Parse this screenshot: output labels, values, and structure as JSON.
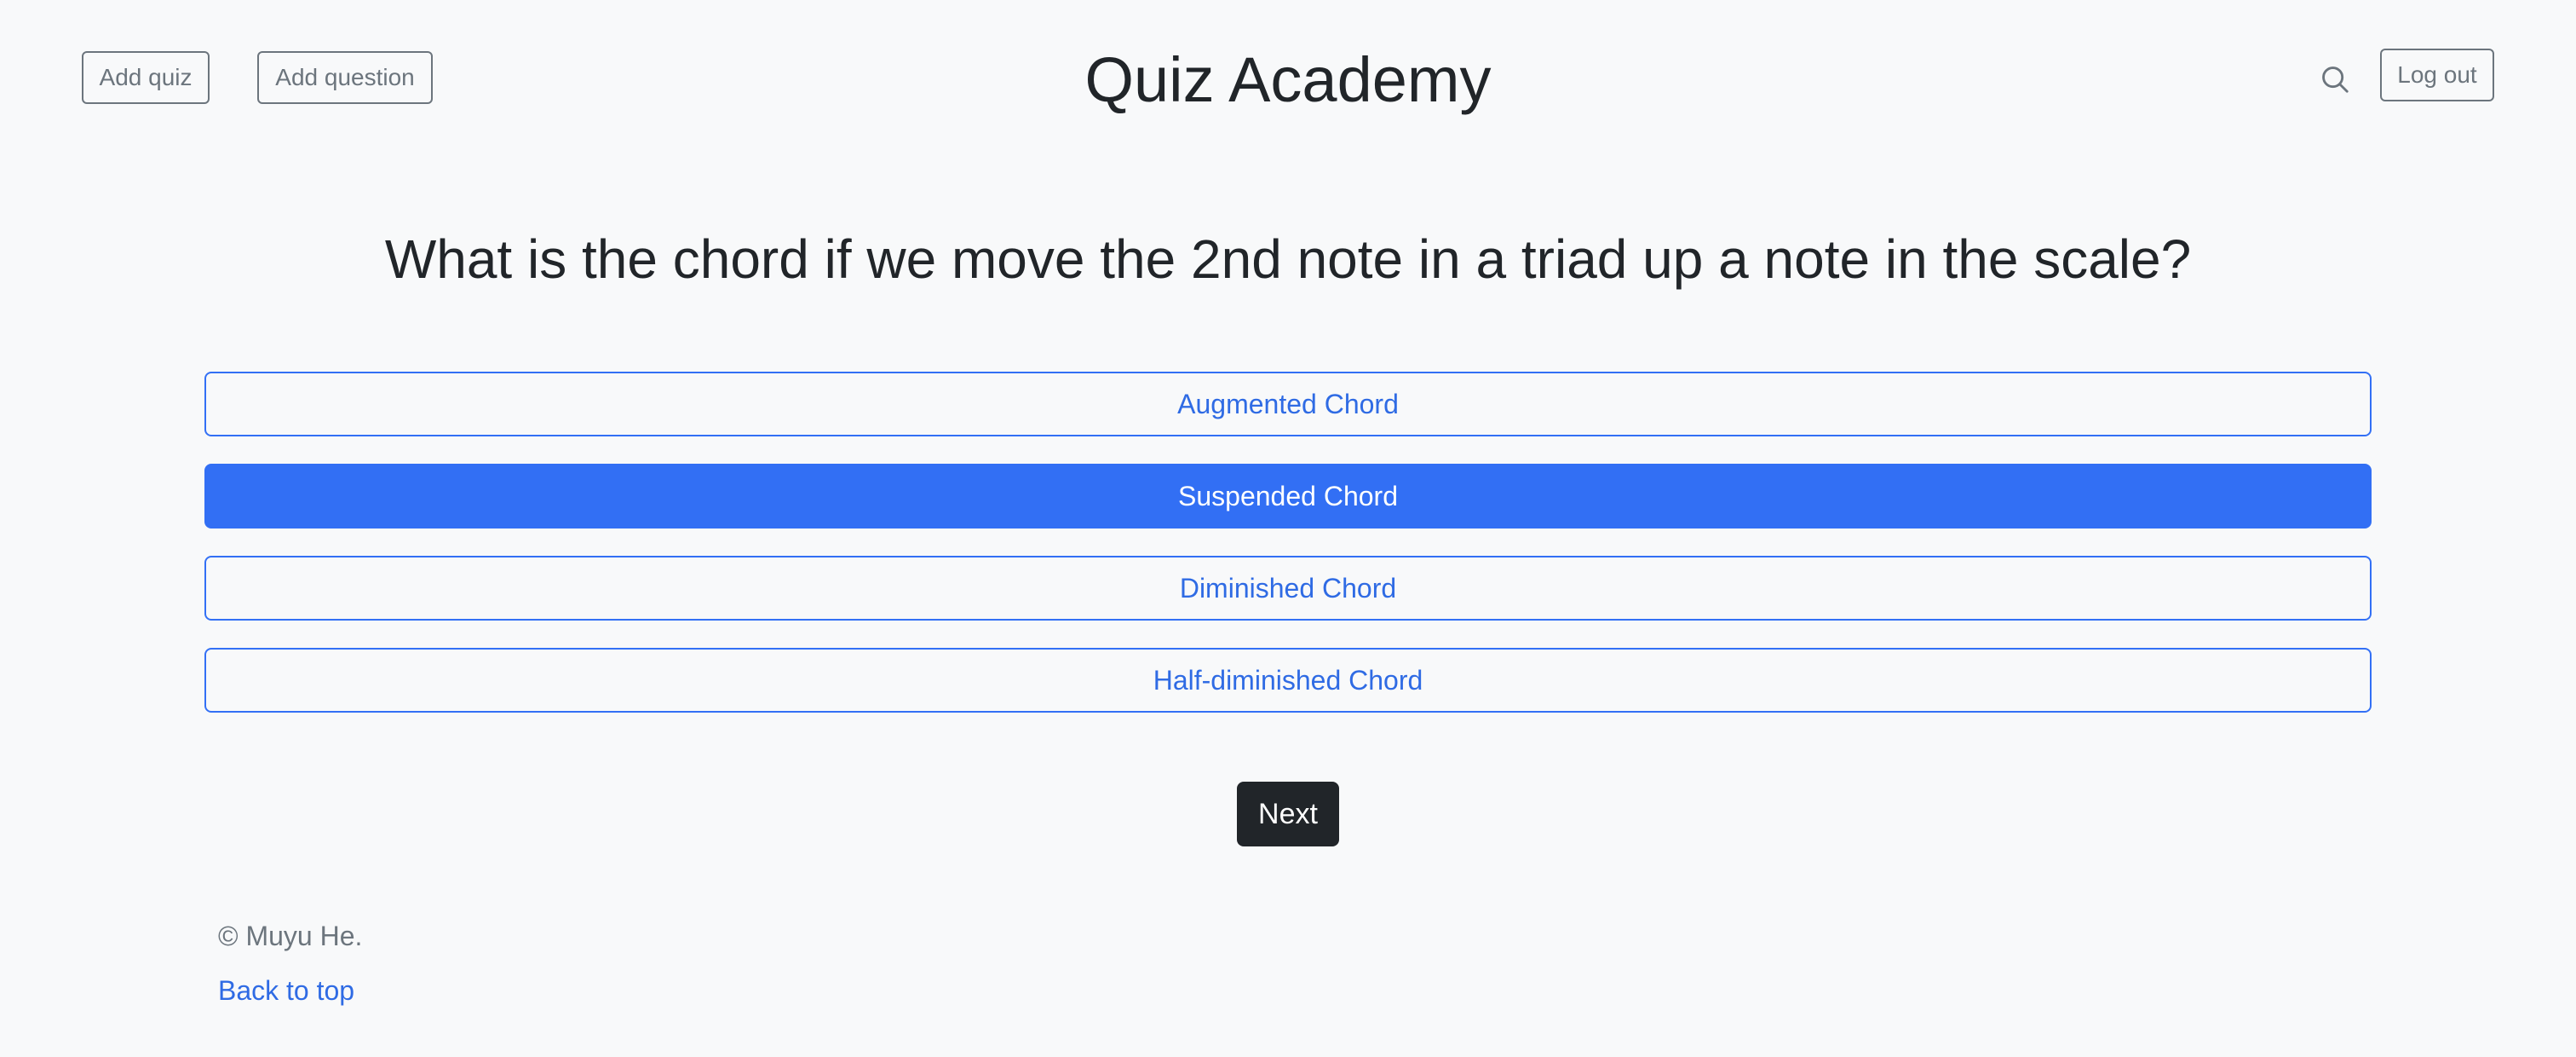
{
  "header": {
    "add_quiz_label": "Add quiz",
    "add_question_label": "Add question",
    "title": "Quiz Academy",
    "search_icon": "search-icon",
    "logout_label": "Log out"
  },
  "quiz": {
    "question": "What is the chord if we move the 2nd note in a triad up a note in the scale?",
    "answers": [
      {
        "label": "Augmented Chord",
        "selected": false
      },
      {
        "label": "Suspended Chord",
        "selected": true
      },
      {
        "label": "Diminished Chord",
        "selected": false
      },
      {
        "label": "Half-diminished Chord",
        "selected": false
      }
    ],
    "next_label": "Next"
  },
  "footer": {
    "copyright": "© Muyu He.",
    "back_to_top": "Back to top"
  },
  "colors": {
    "background": "#f8f9fa",
    "primary": "#326ff4",
    "dark": "#212529",
    "secondary": "#6c757d"
  }
}
